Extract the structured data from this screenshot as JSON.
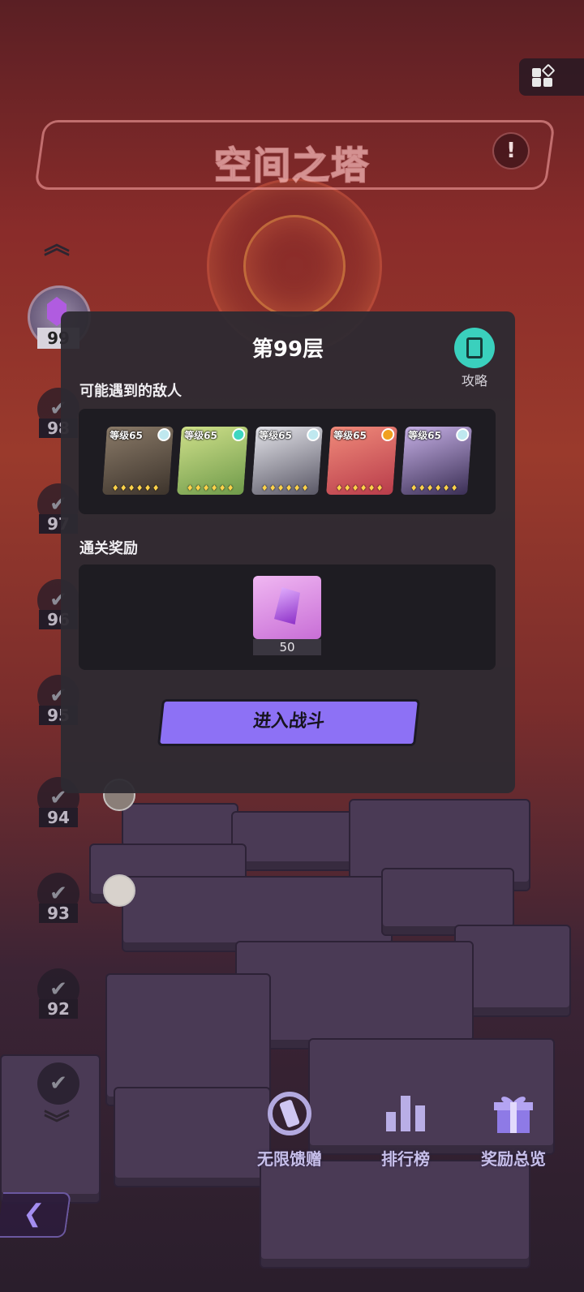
{
  "header": {
    "title": "空间之塔",
    "info_icon": "info-icon",
    "menu_icon": "grid-menu-icon"
  },
  "tower": {
    "current_floor": "99",
    "floors": [
      "98",
      "97",
      "96",
      "95",
      "94",
      "93",
      "92"
    ]
  },
  "modal": {
    "title": "第99层",
    "guide_label": "攻略",
    "enemies_label": "可能遇到的敌人",
    "enemies": [
      {
        "level": "等级65",
        "class_color": "#bfe8ef",
        "art_color": "#5a5046"
      },
      {
        "level": "等级65",
        "class_color": "#3ed6c0",
        "art_color": "#a8c97a"
      },
      {
        "level": "等级65",
        "class_color": "#bfe8ef",
        "art_color": "#8e8e98"
      },
      {
        "level": "等级65",
        "class_color": "#f0a020",
        "art_color": "#d9564f"
      },
      {
        "level": "等级65",
        "class_color": "#bfe8ef",
        "art_color": "#6a5a88"
      }
    ],
    "stars": "♦♦♦♦♦♦",
    "reward_label": "通关奖励",
    "reward": {
      "icon": "purple-gem-icon",
      "quantity": "50"
    },
    "battle_button": "进入战斗"
  },
  "bottom_nav": [
    {
      "label": "无限馈赠",
      "icon": "infinite-gift-icon"
    },
    {
      "label": "排行榜",
      "icon": "leaderboard-icon"
    },
    {
      "label": "奖励总览",
      "icon": "gift-box-icon"
    }
  ],
  "back_button": "❮"
}
